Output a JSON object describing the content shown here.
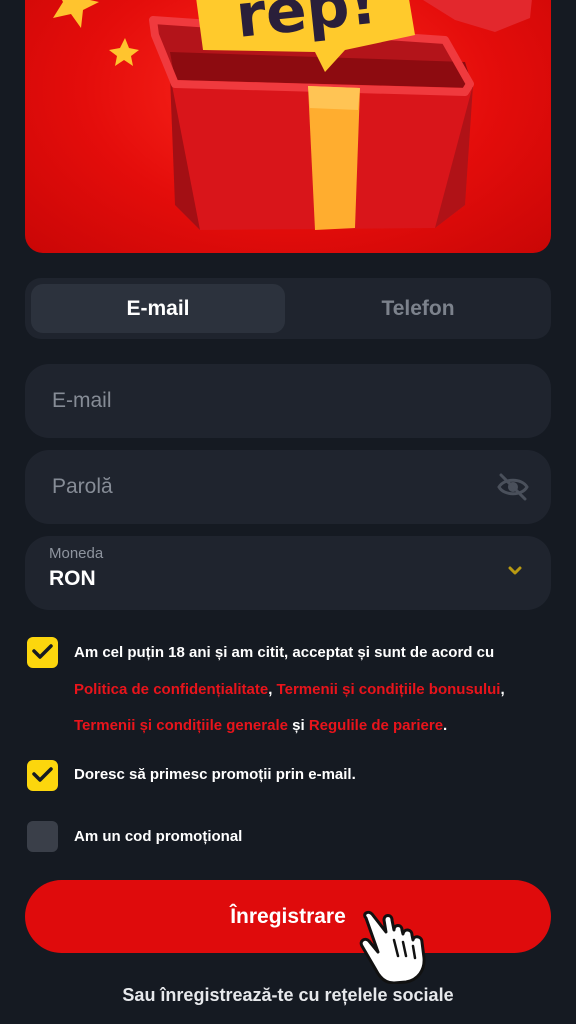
{
  "hero": {
    "badge_text": "rep!"
  },
  "tabs": [
    {
      "label": "E-mail",
      "active": true
    },
    {
      "label": "Telefon",
      "active": false
    }
  ],
  "form": {
    "email_placeholder": "E-mail",
    "password_placeholder": "Parolă",
    "currency_label": "Moneda",
    "currency_value": "RON"
  },
  "consent": {
    "checked": true,
    "line1": "Am cel puțin 18 ani și am citit, acceptat și sunt de acord cu",
    "privacy_link": "Politica de confidențialitate",
    "comma1": ",",
    "bonus_link": "Termenii și condițiile bonusului",
    "comma2": ",",
    "terms_link": "Termenii și condițiile generale",
    "and_text": " și ",
    "betting_link": "Regulile de pariere",
    "period": "."
  },
  "promo_email": {
    "checked": true,
    "label": "Doresc să primesc promoții prin e-mail."
  },
  "promo_code": {
    "checked": false,
    "label": "Am un cod promoțional"
  },
  "register_label": "Înregistrare",
  "social_text": "Sau înregistrează-te cu rețelele sociale",
  "colors": {
    "accent_red": "#df0b0c",
    "link_red": "#e9141b",
    "check_yellow": "#fcd60d",
    "background": "#151a22",
    "field": "#1f242e"
  }
}
